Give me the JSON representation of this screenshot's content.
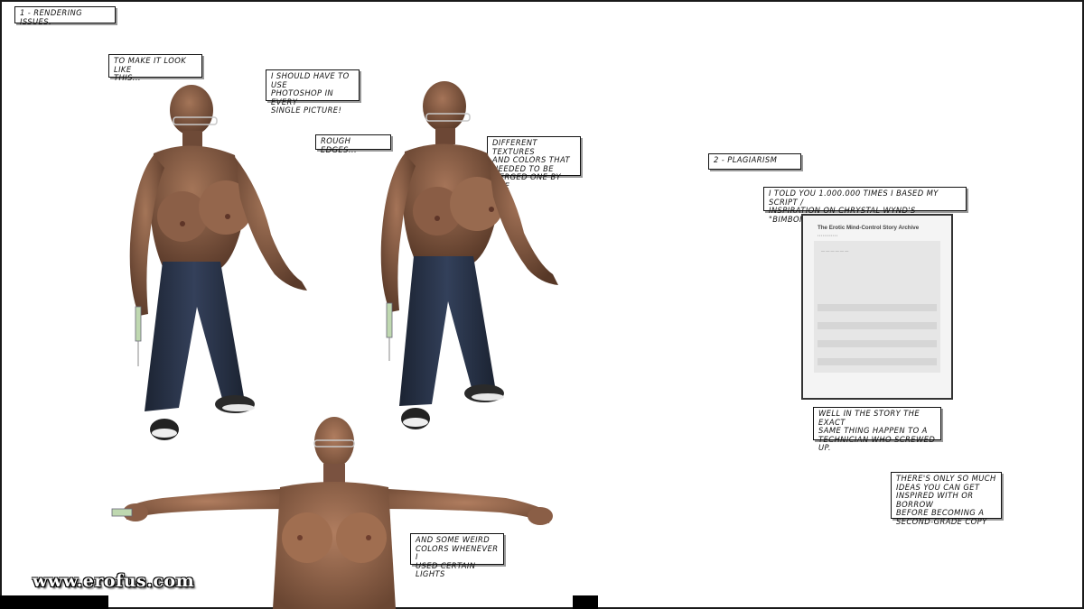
{
  "sections": {
    "rendering_label": "1 - Rendering issues.",
    "plagiarism_label": "2 - Plagiarism"
  },
  "captions": {
    "make_it_look": "To make it look like\nthis...",
    "photoshop": "I should have to use\nphotoshop in every\nsingle picture!",
    "rough_edges": "Rough edges...",
    "textures": "Different textures\nand colors that\nneeded to be\nmerged one by one",
    "weird_colors": "And some weird\ncolors whenever I\nused certain lights",
    "told_you": "I told you 1.000.000 times I based my script /\ninspiration on Chrystal Wynd's \"Bimbomania\"",
    "story_exact": "Well in the story the exact\nsame thing happen to a\ntechnician who screwed up.",
    "only_so_much": "There's only so much\nideas you can get\ninspired with or borrow\nbefore becoming a\nsecond-grade copy"
  },
  "document": {
    "site_title": "The Erotic Mind-Control Story Archive"
  },
  "watermark": "www.erofus.com",
  "colors": {
    "skin": "#8a6048",
    "skin_shadow": "#5e3f2f",
    "jeans": "#2a3344",
    "border": "#111111"
  }
}
